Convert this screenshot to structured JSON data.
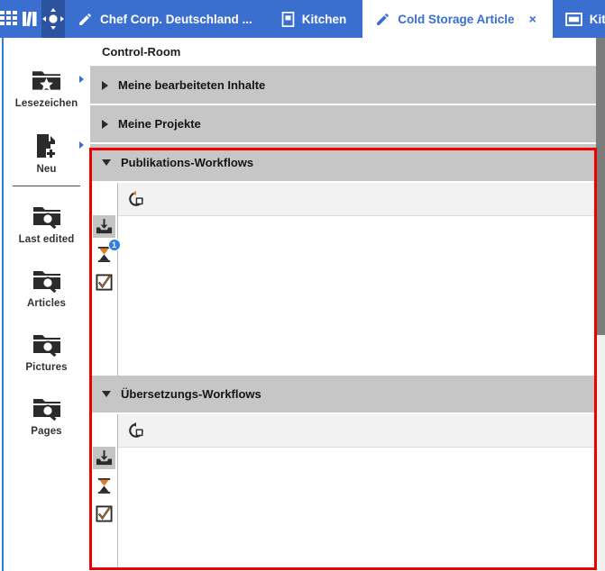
{
  "topbar": {
    "background": "#3b6fcf",
    "active_background": "#2b53a0",
    "icons": [
      {
        "name": "apps-grid-icon",
        "label": "Apps"
      },
      {
        "name": "library-books-icon",
        "label": "Library"
      },
      {
        "name": "control-room-navigator-icon",
        "label": "Control Room"
      }
    ],
    "tabs": [
      {
        "label": "Chef Corp. Deutschland ...",
        "icon": "pencil-icon",
        "active": false,
        "closable": false
      },
      {
        "label": "Kitchen",
        "icon": "document-icon",
        "active": false,
        "closable": false
      },
      {
        "label": "Cold Storage Article",
        "icon": "pencil-icon",
        "active": true,
        "closable": true,
        "close_label": "×"
      },
      {
        "label": "Kit",
        "icon": "window-icon",
        "active": false,
        "closable": false
      }
    ]
  },
  "sidebar": {
    "items": [
      {
        "label": "Lesezeichen",
        "icon": "folder-star-icon",
        "has_arrow": true
      },
      {
        "label": "Neu",
        "icon": "page-plus-icon",
        "has_arrow": true
      },
      {
        "label": "Last edited",
        "icon": "folder-search-icon",
        "has_arrow": false
      },
      {
        "label": "Articles",
        "icon": "folder-search-icon",
        "has_arrow": false
      },
      {
        "label": "Pictures",
        "icon": "folder-search-icon",
        "has_arrow": false
      },
      {
        "label": "Pages",
        "icon": "folder-search-icon",
        "has_arrow": false
      }
    ]
  },
  "main": {
    "breadcrumb": "Control-Room",
    "sections": [
      {
        "title": "Meine bearbeiteten Inhalte",
        "expanded": false
      },
      {
        "title": "Meine Projekte",
        "expanded": false
      },
      {
        "title": "Publikations-Workflows",
        "expanded": true,
        "toolbar": [
          {
            "name": "refresh-icon",
            "label": "Refresh"
          }
        ],
        "tabs": [
          {
            "name": "inbox-tray-icon",
            "label": "Inbox",
            "selected": true,
            "badge": null
          },
          {
            "name": "hourglass-icon",
            "label": "Pending",
            "selected": false,
            "badge": "1"
          },
          {
            "name": "checkbox-checked-icon",
            "label": "Done",
            "selected": false,
            "badge": null
          }
        ],
        "rows": []
      },
      {
        "title": "Übersetzungs-Workflows",
        "expanded": true,
        "toolbar": [
          {
            "name": "refresh-icon",
            "label": "Refresh"
          }
        ],
        "tabs": [
          {
            "name": "inbox-tray-icon",
            "label": "Inbox",
            "selected": true,
            "badge": null
          },
          {
            "name": "hourglass-icon",
            "label": "Pending",
            "selected": false,
            "badge": null
          },
          {
            "name": "checkbox-checked-icon",
            "label": "Done",
            "selected": false,
            "badge": null
          }
        ],
        "rows": []
      }
    ]
  },
  "highlight": {
    "color": "#ee0000",
    "target": "Publikations-Workflows and Übersetzungs-Workflows panels"
  },
  "scrollbar": {
    "thumb_color": "#7c7c7c",
    "track_color": "#f0f0f0"
  }
}
